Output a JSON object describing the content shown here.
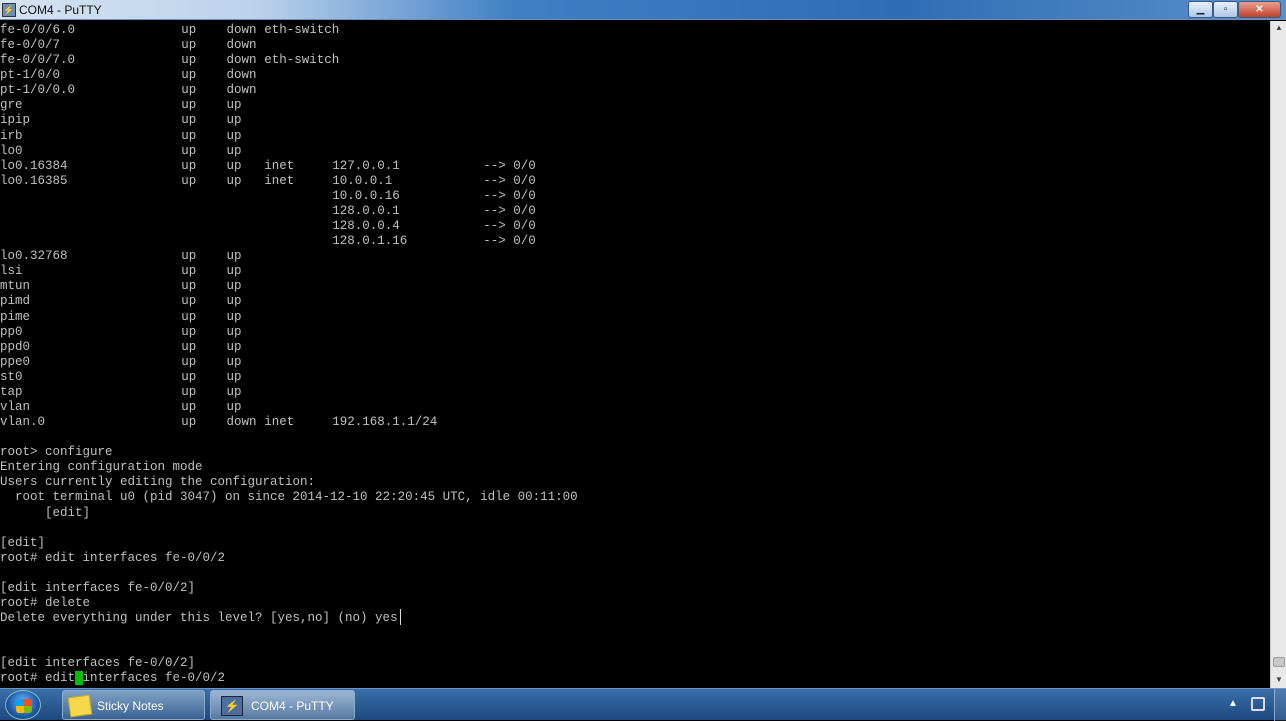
{
  "window": {
    "title": "COM4 - PuTTY",
    "minimize": "▁",
    "maximize": "▫",
    "close": "✕"
  },
  "interfaces": [
    {
      "name": "fe-0/0/6.0",
      "admin": "up",
      "link": "down",
      "proto": "eth-switch",
      "local": "",
      "remote": ""
    },
    {
      "name": "fe-0/0/7",
      "admin": "up",
      "link": "down",
      "proto": "",
      "local": "",
      "remote": ""
    },
    {
      "name": "fe-0/0/7.0",
      "admin": "up",
      "link": "down",
      "proto": "eth-switch",
      "local": "",
      "remote": ""
    },
    {
      "name": "pt-1/0/0",
      "admin": "up",
      "link": "down",
      "proto": "",
      "local": "",
      "remote": ""
    },
    {
      "name": "pt-1/0/0.0",
      "admin": "up",
      "link": "down",
      "proto": "",
      "local": "",
      "remote": ""
    },
    {
      "name": "gre",
      "admin": "up",
      "link": "up",
      "proto": "",
      "local": "",
      "remote": ""
    },
    {
      "name": "ipip",
      "admin": "up",
      "link": "up",
      "proto": "",
      "local": "",
      "remote": ""
    },
    {
      "name": "irb",
      "admin": "up",
      "link": "up",
      "proto": "",
      "local": "",
      "remote": ""
    },
    {
      "name": "lo0",
      "admin": "up",
      "link": "up",
      "proto": "",
      "local": "",
      "remote": ""
    },
    {
      "name": "lo0.16384",
      "admin": "up",
      "link": "up",
      "proto": "inet",
      "local": "127.0.0.1",
      "remote": "--> 0/0"
    },
    {
      "name": "lo0.16385",
      "admin": "up",
      "link": "up",
      "proto": "inet",
      "local": "10.0.0.1",
      "remote": "--> 0/0"
    },
    {
      "name": "",
      "admin": "",
      "link": "",
      "proto": "",
      "local": "10.0.0.16",
      "remote": "--> 0/0"
    },
    {
      "name": "",
      "admin": "",
      "link": "",
      "proto": "",
      "local": "128.0.0.1",
      "remote": "--> 0/0"
    },
    {
      "name": "",
      "admin": "",
      "link": "",
      "proto": "",
      "local": "128.0.0.4",
      "remote": "--> 0/0"
    },
    {
      "name": "",
      "admin": "",
      "link": "",
      "proto": "",
      "local": "128.0.1.16",
      "remote": "--> 0/0"
    },
    {
      "name": "lo0.32768",
      "admin": "up",
      "link": "up",
      "proto": "",
      "local": "",
      "remote": ""
    },
    {
      "name": "lsi",
      "admin": "up",
      "link": "up",
      "proto": "",
      "local": "",
      "remote": ""
    },
    {
      "name": "mtun",
      "admin": "up",
      "link": "up",
      "proto": "",
      "local": "",
      "remote": ""
    },
    {
      "name": "pimd",
      "admin": "up",
      "link": "up",
      "proto": "",
      "local": "",
      "remote": ""
    },
    {
      "name": "pime",
      "admin": "up",
      "link": "up",
      "proto": "",
      "local": "",
      "remote": ""
    },
    {
      "name": "pp0",
      "admin": "up",
      "link": "up",
      "proto": "",
      "local": "",
      "remote": ""
    },
    {
      "name": "ppd0",
      "admin": "up",
      "link": "up",
      "proto": "",
      "local": "",
      "remote": ""
    },
    {
      "name": "ppe0",
      "admin": "up",
      "link": "up",
      "proto": "",
      "local": "",
      "remote": ""
    },
    {
      "name": "st0",
      "admin": "up",
      "link": "up",
      "proto": "",
      "local": "",
      "remote": ""
    },
    {
      "name": "tap",
      "admin": "up",
      "link": "up",
      "proto": "",
      "local": "",
      "remote": ""
    },
    {
      "name": "vlan",
      "admin": "up",
      "link": "up",
      "proto": "",
      "local": "",
      "remote": ""
    },
    {
      "name": "vlan.0",
      "admin": "up",
      "link": "down",
      "proto": "inet",
      "local": "192.168.1.1/24",
      "remote": ""
    }
  ],
  "session_lines": [
    "",
    "root> configure",
    "Entering configuration mode",
    "Users currently editing the configuration:",
    "  root terminal u0 (pid 3047) on since 2014-12-10 22:20:45 UTC, idle 00:11:00",
    "      [edit]",
    "",
    "[edit]",
    "root# edit interfaces fe-0/0/2",
    "",
    "[edit interfaces fe-0/0/2]",
    "root# delete",
    "Delete everything under this level? [yes,no] (no) yes",
    "",
    "",
    "[edit interfaces fe-0/0/2]"
  ],
  "prompt_line": {
    "before_cursor": "root# edit",
    "after_cursor": "interfaces fe-0/0/2"
  },
  "taskbar": {
    "items": [
      {
        "label": "Sticky Notes"
      },
      {
        "label": "COM4 - PuTTY"
      }
    ],
    "tray_arrow": "▲"
  },
  "scrollbar": {
    "up": "▲",
    "down": "▼"
  }
}
